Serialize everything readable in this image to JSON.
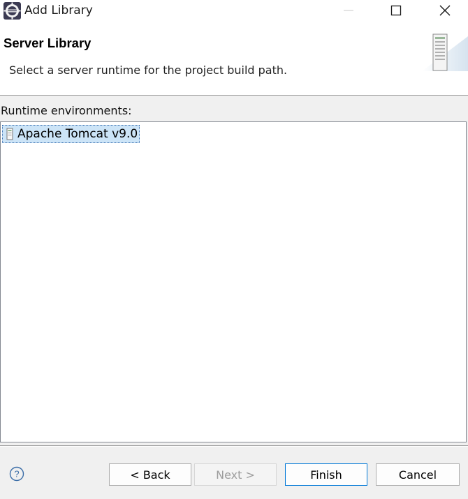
{
  "window": {
    "title": "Add Library",
    "icon": "eclipse-icon"
  },
  "banner": {
    "title": "Server Library",
    "description": "Select a server runtime for the project build path.",
    "graphic": "server-tower-icon"
  },
  "runtimes": {
    "label": "Runtime environments:",
    "items": [
      {
        "label": "Apache Tomcat v9.0",
        "icon": "tomcat-server-icon",
        "selected": true
      }
    ]
  },
  "footer": {
    "back_label": "< Back",
    "next_label": "Next >",
    "finish_label": "Finish",
    "cancel_label": "Cancel",
    "help_icon": "help-icon"
  },
  "colors": {
    "selection": "#cce4f7",
    "default_button_border": "#0078d7",
    "disabled_text": "#9c9c9c"
  }
}
